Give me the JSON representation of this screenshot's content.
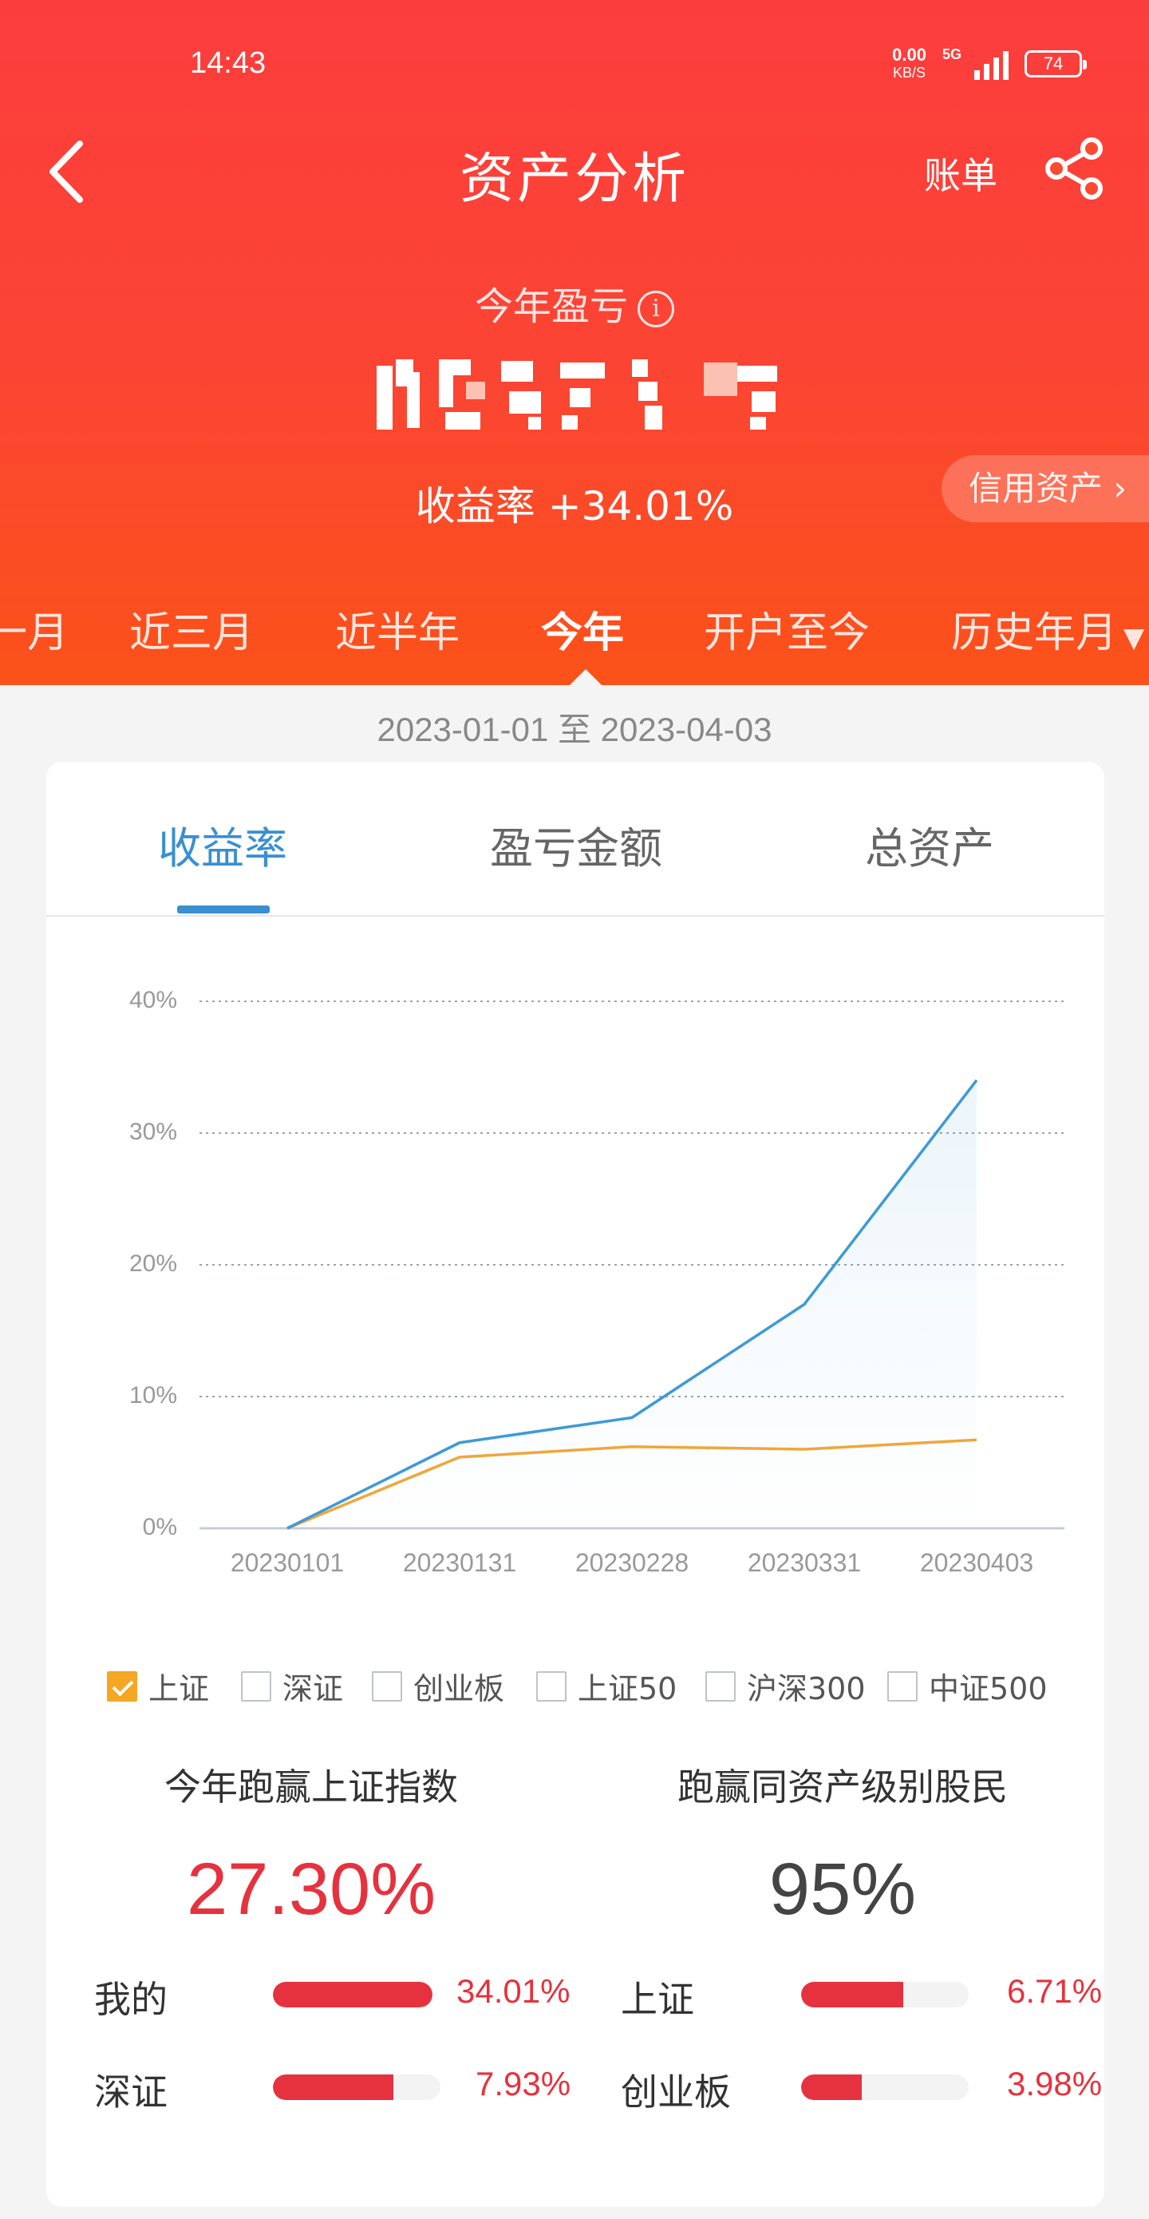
{
  "status_bar": {
    "time": "14:43",
    "net_speed": "0.00",
    "net_unit": "KB/S",
    "network": "5G",
    "battery": "74"
  },
  "nav": {
    "title": "资产分析",
    "bill_label": "账单"
  },
  "summary": {
    "pnl_label": "今年盈亏",
    "yield_text": "收益率 +34.01%",
    "credit_label": "信用资产"
  },
  "periods": {
    "items": [
      "近一月",
      "近三月",
      "近半年",
      "今年",
      "开户至今",
      "历史年月"
    ],
    "active": "今年"
  },
  "date_range": "2023-01-01 至 2023-04-03",
  "tabs": {
    "items": [
      "收益率",
      "盈亏金额",
      "总资产"
    ],
    "active": "收益率"
  },
  "chart_data": {
    "type": "line",
    "x": [
      "20230101",
      "20230131",
      "20230228",
      "20230331",
      "20230403"
    ],
    "yticks": [
      "40%",
      "30%",
      "20%",
      "10%",
      "0%"
    ],
    "ylim": [
      0,
      40
    ],
    "grid": true,
    "series": [
      {
        "name": "我的",
        "color": "#3d9ad6",
        "values": [
          0,
          6.5,
          8.4,
          17,
          34.01
        ]
      },
      {
        "name": "上证",
        "color": "#f0a63a",
        "values": [
          0,
          5.4,
          6.2,
          6.0,
          6.71
        ]
      }
    ]
  },
  "legend": {
    "items": [
      {
        "label": "上证",
        "checked": true
      },
      {
        "label": "深证",
        "checked": false
      },
      {
        "label": "创业板",
        "checked": false
      },
      {
        "label": "上证50",
        "checked": false
      },
      {
        "label": "沪深300",
        "checked": false
      },
      {
        "label": "中证500",
        "checked": false
      }
    ]
  },
  "stats": {
    "beat_index_label": "今年跑赢上证指数",
    "beat_index_value": "27.30%",
    "beat_index_color": "#e5323e",
    "beat_peers_label": "跑赢同资产级别股民",
    "beat_peers_value": "95%",
    "beat_peers_color": "#444444"
  },
  "comparison": [
    {
      "label": "我的",
      "pct": "34.01%",
      "fill": 1.0
    },
    {
      "label": "上证",
      "pct": "6.71%",
      "fill": 0.61
    },
    {
      "label": "深证",
      "pct": "7.93%",
      "fill": 0.72
    },
    {
      "label": "创业板",
      "pct": "3.98%",
      "fill": 0.36
    }
  ]
}
